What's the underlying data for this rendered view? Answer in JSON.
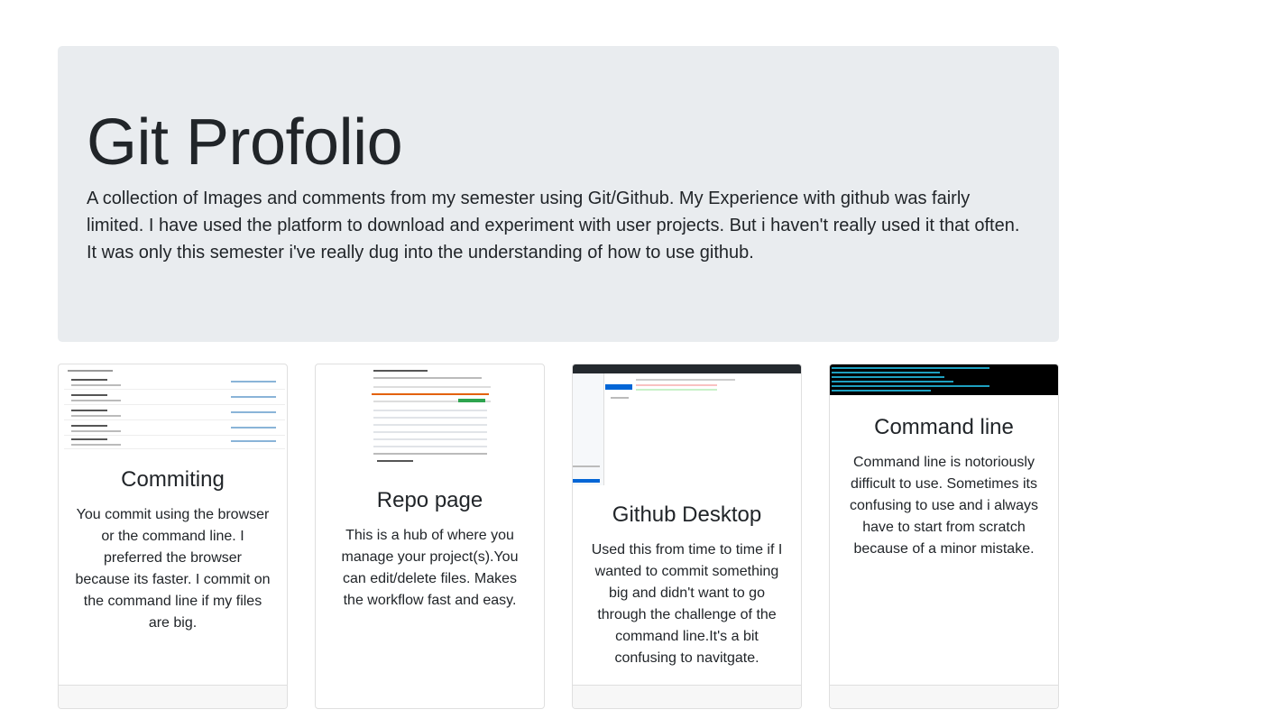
{
  "header": {
    "title": "Git Profolio",
    "lead": "A collection of Images and comments from my semester using Git/Github. My Experience with github was fairly limited. I have used the platform to download and experiment with user projects. But i haven't really used it that often. It was only this semester i've really dug into the understanding of how to use github."
  },
  "cards": [
    {
      "title": "Commiting",
      "text": "You commit using the browser or the command line. I preferred the browser because its faster. I commit on the command line if my files are big.",
      "image": "commits-screenshot"
    },
    {
      "title": "Repo page",
      "text": "This is a hub of where you manage your project(s).You can edit/delete files. Makes the workflow fast and easy.",
      "image": "repo-page-screenshot"
    },
    {
      "title": "Github Desktop",
      "text": "Used this from time to time if I wanted to commit something big and didn't want to go through the challenge of the command line.It's a bit confusing to navitgate.",
      "image": "github-desktop-screenshot"
    },
    {
      "title": "Command line",
      "text": "Command line is notoriously difficult to use. Sometimes its confusing to use and i always have to start from scratch because of a minor mistake.",
      "image": "terminal-screenshot"
    }
  ],
  "colors": {
    "jumbotron_bg": "#e9ecef",
    "card_border": "#dfdfdf",
    "card_footer_bg": "#f7f7f7",
    "text": "#212529",
    "terminal_bg": "#000000",
    "terminal_text": "#1ea0c0"
  }
}
